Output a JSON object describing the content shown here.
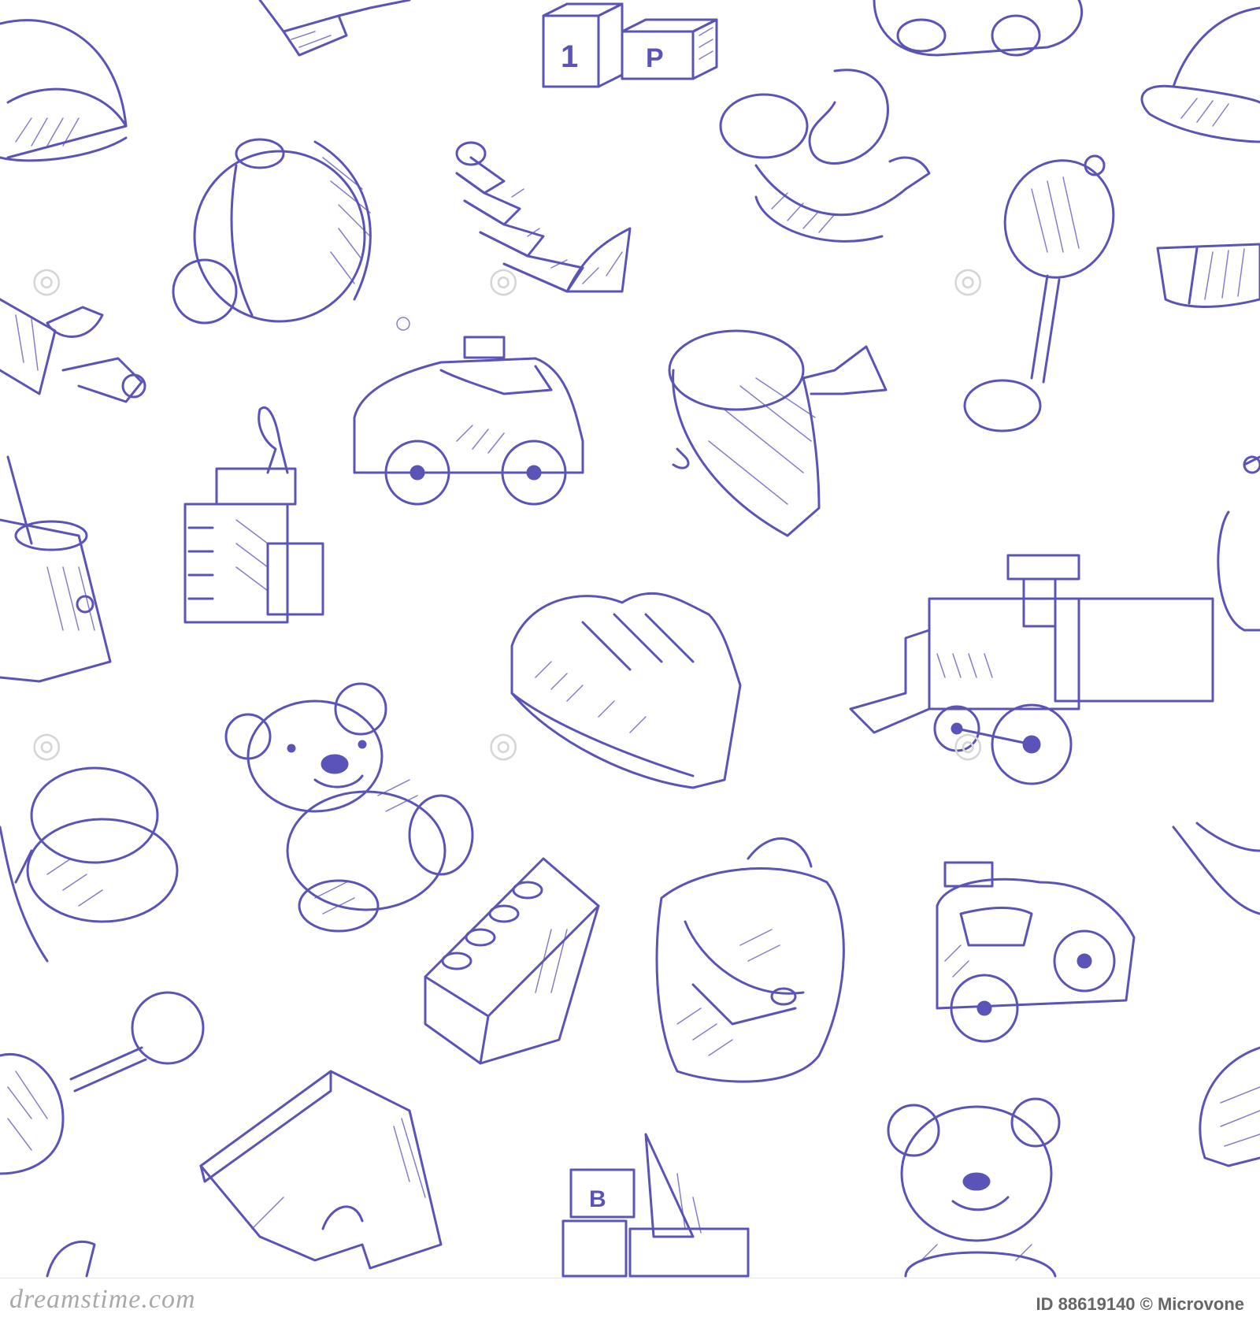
{
  "artwork": {
    "line_color": "#5b54b8",
    "background": "#ffffff",
    "watermark_text": "dreamstime",
    "glyphs": {
      "block_one": "1",
      "block_p": "P",
      "block_b": "B"
    }
  },
  "footer": {
    "brand_text": "dreamstime.com",
    "id_text": "ID 88619140 © Microvone"
  }
}
